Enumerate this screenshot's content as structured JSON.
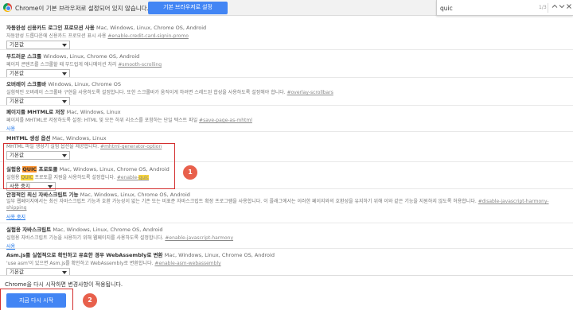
{
  "infobar": {
    "message": "Chrome이 기본 브라우저로 설정되어 있지 않습니다.",
    "button": "기본 브라우저로 설정"
  },
  "findbar": {
    "query": "quic",
    "count": "1/3",
    "up_icon": "chevron-up-icon",
    "down_icon": "chevron-down-icon",
    "close_icon": "close-icon"
  },
  "flags": [
    {
      "title": "자동완성 신용카드 로그인 프로모션 사용",
      "platform": "Mac, Windows, Linux, Chrome OS, Android",
      "desc": "자동완성 드롭다운에 신용카드 프로모션 표시 사용",
      "hash": "#enable-credit-card-signin-promo",
      "select": "기본값"
    },
    {
      "title": "부드러운 스크롤",
      "platform": "Windows, Linux, Chrome OS, Android",
      "desc": "페이지 콘텐츠를 스크롤할 때 부드럽게 애니메이션 처리",
      "hash": "#smooth-scrolling",
      "select": "기본값"
    },
    {
      "title": "오버레이 스크롤바",
      "platform": "Windows, Linux, Chrome OS",
      "desc": "실험적인 오버레이 스크롤바 구현을 사용하도록 설정합니다. 또한 스크롤바가 움직이게 하려면 스레드된 합성을 사용하도록 설정해야 합니다.",
      "hash": "#overlay-scrollbars",
      "select": "기본값"
    },
    {
      "title": "페이지를 MHTML로 저장",
      "platform": "Mac, Windows, Linux",
      "desc": "페이지를 MHTML로 저장하도록 설정: HTML 및 모든 하위 리소스를 포함하는 단일 텍스트 파일",
      "hash": "#save-page-as-mhtml",
      "link": "사용"
    },
    {
      "title": "MHTML 생성 옵션",
      "platform": "Mac, Windows, Linux",
      "desc": "MHTML 파일 생성기 실험 옵션을 제공합니다.",
      "hash": "#mhtml-generator-option",
      "select": "기본값"
    },
    {
      "title_a": "실험용 ",
      "title_hl": "QUIC",
      "title_b": " 프로토콜",
      "platform": "Mac, Windows, Linux, Chrome OS, Android",
      "desc_a": "실험용 ",
      "desc_hl": "QUIC",
      "desc_b": " 프로토콜 지원을 사용하도록 설정합니다.",
      "hash_a": "#enable-",
      "hash_hl": "quic",
      "select": "사용 중지"
    },
    {
      "title": "안정적인 최신 자바스크립트 기능",
      "platform": "Mac, Windows, Linux, Chrome OS, Android",
      "desc": "일부 웹페이지에서는 최신 자바스크립트 기능과 호환 가능성이 없는 기존 또는 비표준 자바스크립트 확장 프로그램을 사용합니다. 이 플래그에서는 이러한 페이지와의 호환성을 유지하기 위해 이와 같은 기능을 지원하지 않도록 허용합니다.",
      "hash": "#disable-javascript-harmony-shipping",
      "link": "사용 중지"
    },
    {
      "title": "실험용 자바스크립트",
      "platform": "Mac, Windows, Linux, Chrome OS, Android",
      "desc": "실험용 자바스크립트 기능을 사용하기 위해 웹페이지를 사용하도록 설정합니다.",
      "hash": "#enable-javascript-harmony",
      "link": "사용"
    },
    {
      "title": "Asm.js를 실험적으로 확인하고 유효한 경우 WebAssembly로 변환",
      "platform": "Mac, Windows, Linux, Chrome OS, Android",
      "desc": "'use asm'이 있으면 Asm.js를 확인하고 WebAssembly로 변환합니다.",
      "hash": "#enable-asm-webassembly",
      "select": "기본값"
    }
  ],
  "bottom": {
    "message": "Chrome을 다시 시작하면 변경사항이 적용됩니다.",
    "restart_button": "지금 다시 시작"
  },
  "badges": [
    "1",
    "2"
  ],
  "colors": {
    "accent": "#4285f4",
    "annotation": "#d32f2f",
    "badge": "#e8604c",
    "highlight": "#fdd835",
    "highlight_active": "#ff9632"
  }
}
